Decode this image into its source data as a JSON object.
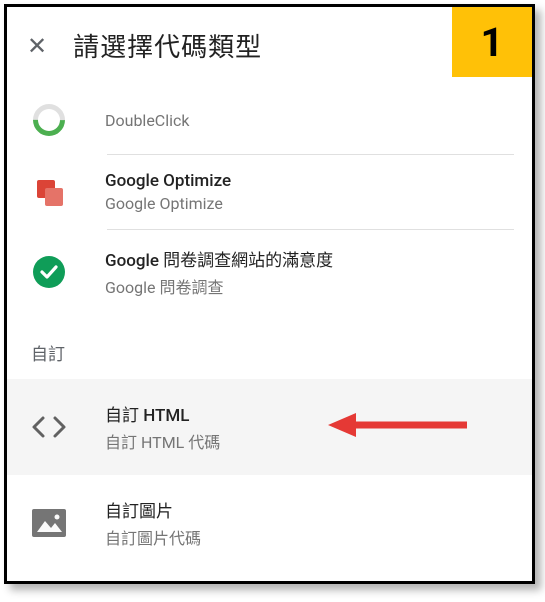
{
  "callout": {
    "number": "1"
  },
  "header": {
    "title": "請選擇代碼類型"
  },
  "items": {
    "doubleclick": {
      "subtitle": "DoubleClick"
    },
    "optimize": {
      "title": "Google Optimize",
      "subtitle": "Google Optimize"
    },
    "survey": {
      "title": "Google 問卷調查網站的滿意度",
      "subtitle": "Google 問卷調查"
    },
    "custom_html": {
      "title": "自訂 HTML",
      "subtitle": "自訂 HTML 代碼"
    },
    "custom_image": {
      "title": "自訂圖片",
      "subtitle": "自訂圖片代碼"
    }
  },
  "sections": {
    "custom": "自訂"
  }
}
